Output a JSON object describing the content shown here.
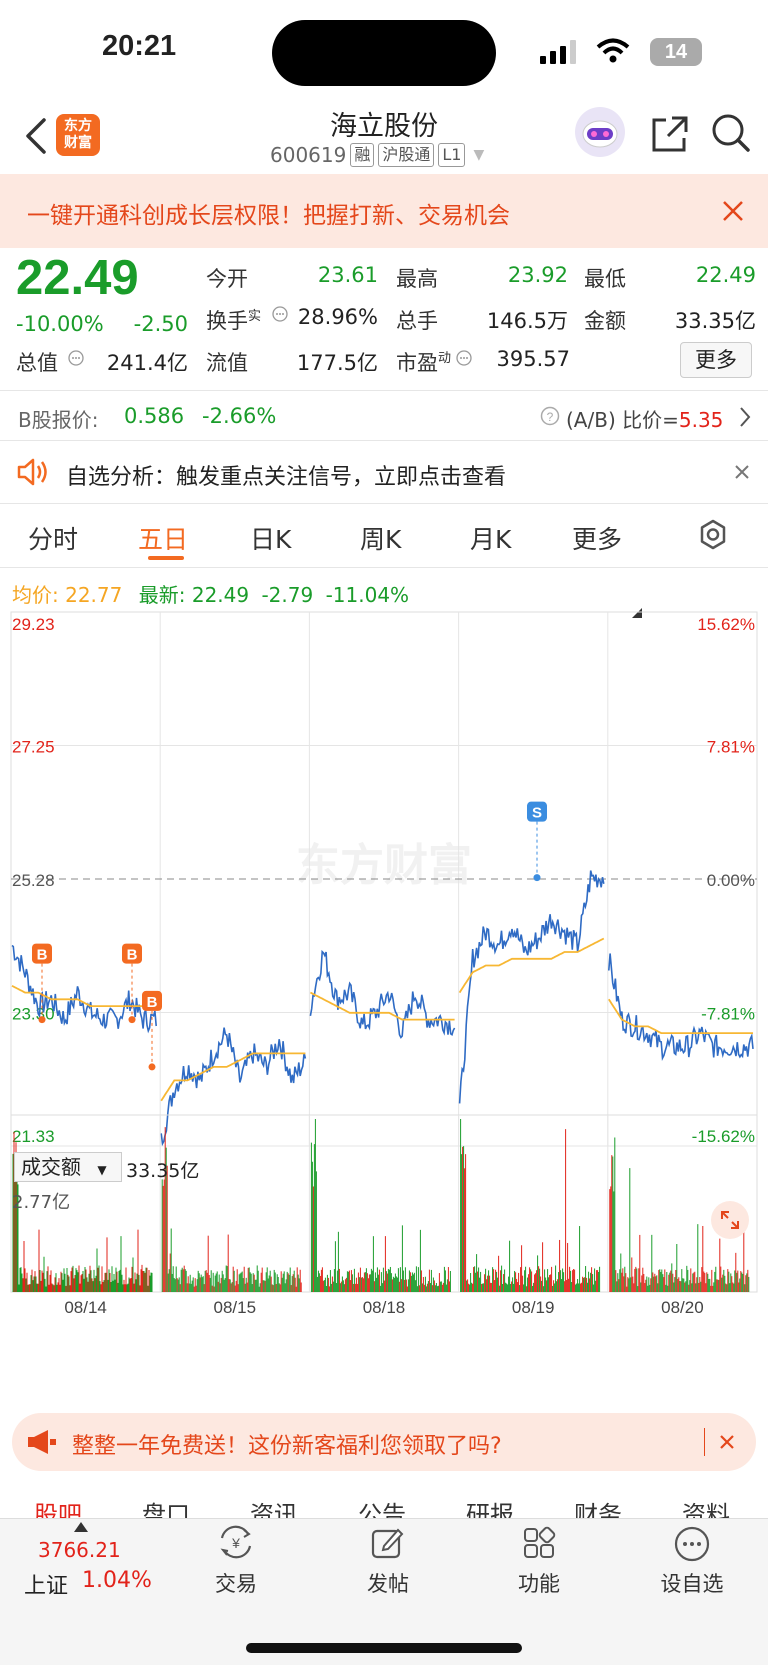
{
  "status": {
    "time": "20:21",
    "battery": "14"
  },
  "header": {
    "logo": "东方\n财富",
    "name": "海立股份",
    "code": "600619",
    "tags": [
      "融",
      "沪股通",
      "L1"
    ]
  },
  "banner": {
    "text": "一键开通科创成长层权限！把握打新、交易机会"
  },
  "quote": {
    "price": "22.49",
    "change_pct": "-10.00%",
    "change": "-2.50",
    "rows": [
      [
        [
          "今开",
          "23.61",
          "green"
        ],
        [
          "最高",
          "23.92",
          "green"
        ],
        [
          "最低",
          "22.49",
          "green"
        ]
      ],
      [
        [
          "换手",
          "28.96%",
          "dark"
        ],
        [
          "总手",
          "146.5万",
          "dark"
        ],
        [
          "金额",
          "33.35亿",
          "dark"
        ]
      ],
      [
        [
          "总值",
          "241.4亿",
          "dark"
        ],
        [
          "流值",
          "177.5亿",
          "dark"
        ],
        [
          "市盈",
          "395.57",
          "dark"
        ]
      ]
    ],
    "turnover_sup": "实",
    "pe_sup": "动",
    "more": "更多"
  },
  "b_share": {
    "label": "B股报价:",
    "price": "0.586",
    "pct": "-2.66%",
    "ratio_label": "(A/B) 比价=",
    "ratio": "5.35"
  },
  "alert": {
    "text": "自选分析：触发重点关注信号，立即点击查看"
  },
  "tabs": [
    "分时",
    "五日",
    "日K",
    "周K",
    "月K",
    "更多"
  ],
  "active_tab": "五日",
  "chart_info": {
    "avg_label": "均价:",
    "avg": "22.77",
    "latest_label": "最新:",
    "latest": "22.49",
    "chg": "-2.79",
    "pct": "-11.04%"
  },
  "chart_data": {
    "type": "line",
    "price_axis": [
      "29.23",
      "27.25",
      "25.28",
      "23.30",
      "21.33"
    ],
    "pct_axis": [
      "15.62%",
      "7.81%",
      "0.00%",
      "-7.81%",
      "-15.62%"
    ],
    "x_labels": [
      "08/14",
      "08/15",
      "08/18",
      "08/19",
      "08/20"
    ],
    "ylim": [
      21.33,
      29.23
    ],
    "reference": 25.28,
    "series": [
      {
        "name": "最新",
        "color": "#2f6bc4",
        "days": [
          [
            24.3,
            23.9,
            23.4,
            23.5,
            23.2,
            23.6,
            23.3,
            23.2,
            23.2,
            23.5,
            23.2,
            23.2
          ],
          [
            21.4,
            22.2,
            22.5,
            22.3,
            22.7,
            23.0,
            22.3,
            22.7,
            22.5,
            22.9,
            22.3,
            22.6
          ],
          [
            23.4,
            24.2,
            23.5,
            23.6,
            23.1,
            23.3,
            23.6,
            23.0,
            23.6,
            23.2,
            23.2,
            23.1
          ],
          [
            21.9,
            24.1,
            24.5,
            24.3,
            24.6,
            24.2,
            24.4,
            24.7,
            24.5,
            24.3,
            25.3,
            25.3
          ],
          [
            24.1,
            23.2,
            23.1,
            23.0,
            22.8,
            22.8,
            22.8,
            23.0,
            22.8,
            22.8,
            22.8,
            22.8
          ]
        ]
      },
      {
        "name": "均价",
        "color": "#f7b733",
        "days": [
          [
            23.7,
            23.6,
            23.6,
            23.5,
            23.5,
            23.5,
            23.4,
            23.4,
            23.4,
            23.4,
            23.4,
            23.4
          ],
          [
            22.0,
            22.3,
            22.3,
            22.4,
            22.5,
            22.5,
            22.6,
            22.7,
            22.7,
            22.7,
            22.7,
            22.7
          ],
          [
            23.6,
            23.5,
            23.4,
            23.3,
            23.3,
            23.3,
            23.3,
            23.2,
            23.2,
            23.2,
            23.2,
            23.2
          ],
          [
            23.6,
            23.9,
            24.0,
            24.0,
            24.1,
            24.1,
            24.1,
            24.1,
            24.2,
            24.2,
            24.3,
            24.4
          ],
          [
            23.5,
            23.2,
            23.1,
            23.1,
            23.0,
            23.0,
            23.0,
            23.0,
            23.0,
            23.0,
            23.0,
            23.0
          ]
        ]
      }
    ],
    "markers": [
      "B",
      "B",
      "B",
      "S"
    ],
    "volume_label": "成交额",
    "volume_total": "33.35亿",
    "volume_max": "2.77亿"
  },
  "promo": {
    "text": "整整一年免费送！这份新客福利您领取了吗?"
  },
  "detail_tabs": [
    "股吧",
    "盘口",
    "资讯",
    "公告",
    "研报",
    "财务",
    "资料"
  ],
  "bottom_nav": {
    "index_value": "3766.21",
    "index_name": "上证",
    "index_pct": "1.04%",
    "items": [
      "交易",
      "发帖",
      "功能",
      "设自选"
    ]
  },
  "watermark": "东方财富"
}
